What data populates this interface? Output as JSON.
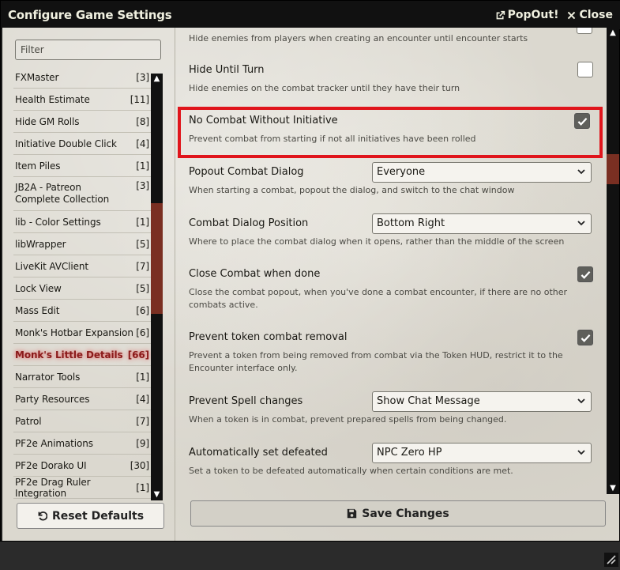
{
  "window": {
    "title": "Configure Game Settings",
    "popout_label": "PopOut!",
    "close_label": "Close"
  },
  "sidebar": {
    "filter_placeholder": "Filter",
    "items": [
      {
        "label": "FXMaster",
        "count": "[3]"
      },
      {
        "label": "Health Estimate",
        "count": "[11]"
      },
      {
        "label": "Hide GM Rolls",
        "count": "[8]"
      },
      {
        "label": "Initiative Double Click",
        "count": "[4]"
      },
      {
        "label": "Item Piles",
        "count": "[1]"
      },
      {
        "label": "JB2A - Patreon Complete Collection",
        "count": "[3]"
      },
      {
        "label": "lib - Color Settings",
        "count": "[1]"
      },
      {
        "label": "libWrapper",
        "count": "[5]"
      },
      {
        "label": "LiveKit AVClient",
        "count": "[7]"
      },
      {
        "label": "Lock View",
        "count": "[5]"
      },
      {
        "label": "Mass Edit",
        "count": "[6]"
      },
      {
        "label": "Monk's Hotbar Expansion",
        "count": "[6]"
      },
      {
        "label": "Monk's Little Details",
        "count": "[66]"
      },
      {
        "label": "Narrator Tools",
        "count": "[1]"
      },
      {
        "label": "Party Resources",
        "count": "[4]"
      },
      {
        "label": "Patrol",
        "count": "[7]"
      },
      {
        "label": "PF2e Animations",
        "count": "[9]"
      },
      {
        "label": "PF2e Dorako UI",
        "count": "[30]"
      },
      {
        "label": "PF2e Drag Ruler Integration",
        "count": "[1]"
      }
    ],
    "reset_label": "Reset Defaults"
  },
  "settings": {
    "top_hint": "Hide enemies from players when creating an encounter until encounter starts",
    "hide_until_turn": {
      "label": "Hide Until Turn",
      "hint": "Hide enemies on the combat tracker until they have their turn",
      "checked": false
    },
    "no_combat": {
      "label": "No Combat Without Initiative",
      "hint": "Prevent combat from starting if not all initiatives have been rolled",
      "checked": true
    },
    "popout_combat": {
      "label": "Popout Combat Dialog",
      "value": "Everyone",
      "hint": "When starting a combat, popout the dialog, and switch to the chat window"
    },
    "dialog_position": {
      "label": "Combat Dialog Position",
      "value": "Bottom Right",
      "hint": "Where to place the combat dialog when it opens, rather than the middle of the screen"
    },
    "close_combat": {
      "label": "Close Combat when done",
      "hint": "Close the combat popout, when you've done a combat encounter, if there are no other combats active.",
      "checked": true
    },
    "prevent_removal": {
      "label": "Prevent token combat removal",
      "hint": "Prevent a token from being removed from combat via the Token HUD, restrict it to the Encounter interface only.",
      "checked": true
    },
    "prevent_spell": {
      "label": "Prevent Spell changes",
      "value": "Show Chat Message",
      "hint": "When a token is in combat, prevent prepared spells from being changed."
    },
    "auto_defeated": {
      "label": "Automatically set defeated",
      "value": "NPC Zero HP",
      "hint": "Set a token to be defeated automatically when certain conditions are met."
    }
  },
  "footer": {
    "save_label": "Save Changes"
  },
  "colors": {
    "highlight": "#e0151c",
    "active_category": "#8a1a1a",
    "scroll_thumb": "#7a2f22"
  }
}
